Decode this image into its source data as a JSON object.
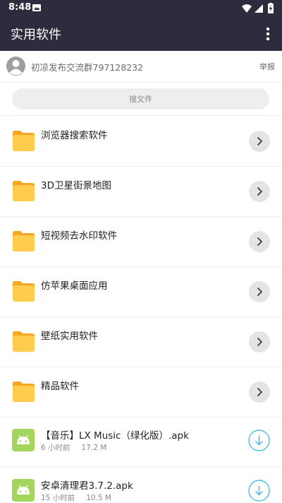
{
  "status_bar": {
    "time": "8:48"
  },
  "app_bar": {
    "title": "实用软件",
    "menu_icon": "more-vert-icon"
  },
  "owner": {
    "name": "初凉发布交流群797128232",
    "report_label": "举报"
  },
  "search": {
    "placeholder": "搜文件"
  },
  "folders": [
    {
      "label": "浏览器搜索软件"
    },
    {
      "label": "3D卫星街景地图"
    },
    {
      "label": "短视频去水印软件"
    },
    {
      "label": "仿苹果桌面应用"
    },
    {
      "label": "壁纸实用软件"
    },
    {
      "label": "精品软件"
    }
  ],
  "files": [
    {
      "name": "【音乐】LX Music（绿化版）.apk",
      "time": "6 小时前",
      "size": "17.2 M"
    },
    {
      "name": "安卓清理君3.7.2.apk",
      "time": "15 小时前",
      "size": "10.5 M"
    }
  ],
  "colors": {
    "app_bar": "#2c2c3e",
    "folder": "#ffcc4d",
    "folder_back": "#f5a623",
    "apk_icon": "#a4d65e",
    "download_accent": "#29b6f6",
    "chevron_bg": "#e4e4e4"
  }
}
